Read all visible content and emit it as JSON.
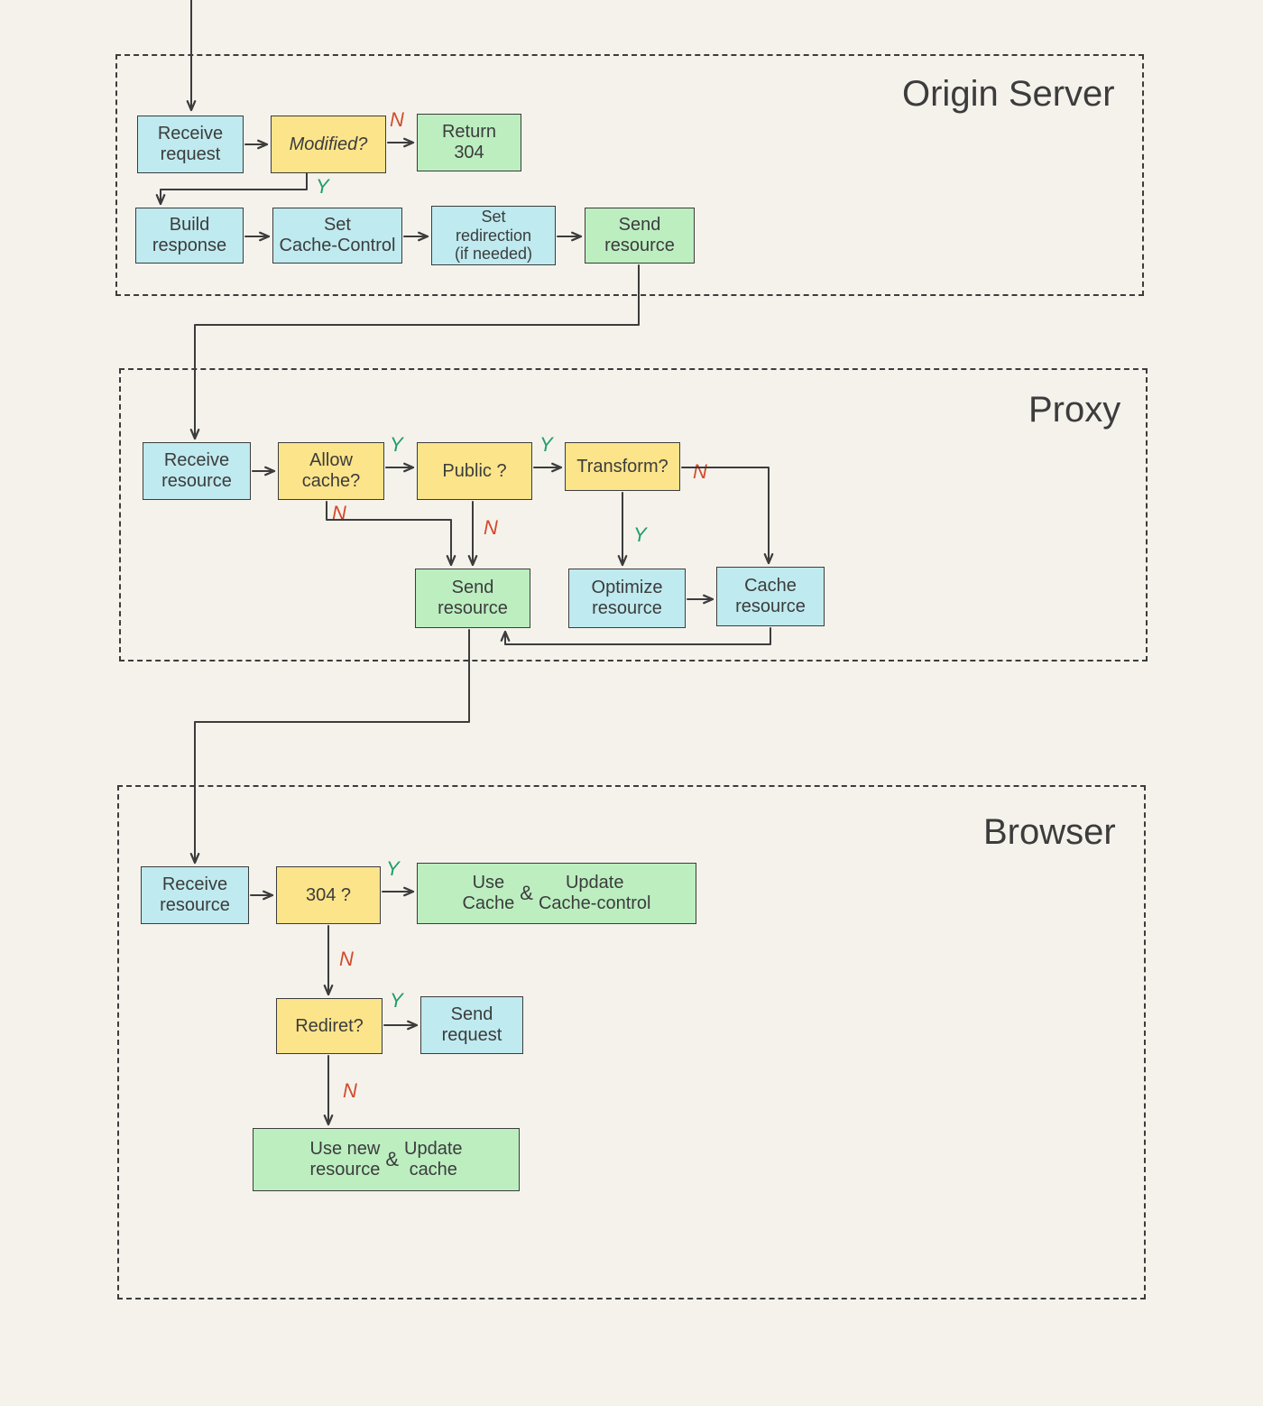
{
  "sections": {
    "origin": {
      "title": "Origin Server"
    },
    "proxy": {
      "title": "Proxy"
    },
    "browser": {
      "title": "Browser"
    }
  },
  "nodes": {
    "o_receive_req": "Receive\nrequest",
    "o_modified": "Modified?",
    "o_return_304": "Return\n304",
    "o_build_resp": "Build\nresponse",
    "o_set_cc": "Set\nCache-Control",
    "o_set_redir": "Set\nredirection\n(if needed)",
    "o_send_res": "Send\nresource",
    "p_receive_res": "Receive\nresource",
    "p_allow_cache": "Allow\ncache?",
    "p_public": "Public ?",
    "p_transform": "Transform?",
    "p_send_res": "Send\nresource",
    "p_optimize": "Optimize\nresource",
    "p_cache_res": "Cache\nresource",
    "b_receive_res": "Receive\nresource",
    "b_304": "304 ?",
    "b_use_cache": "Use\nCache",
    "b_and1": "&",
    "b_update_cc": "Update\nCache-control",
    "b_redirect": "Rediret?",
    "b_send_req": "Send\nrequest",
    "b_use_new": "Use new\nresource",
    "b_and2": "&",
    "b_update_cache": "Update\ncache"
  },
  "edge_labels": {
    "Y": "Y",
    "N": "N"
  }
}
